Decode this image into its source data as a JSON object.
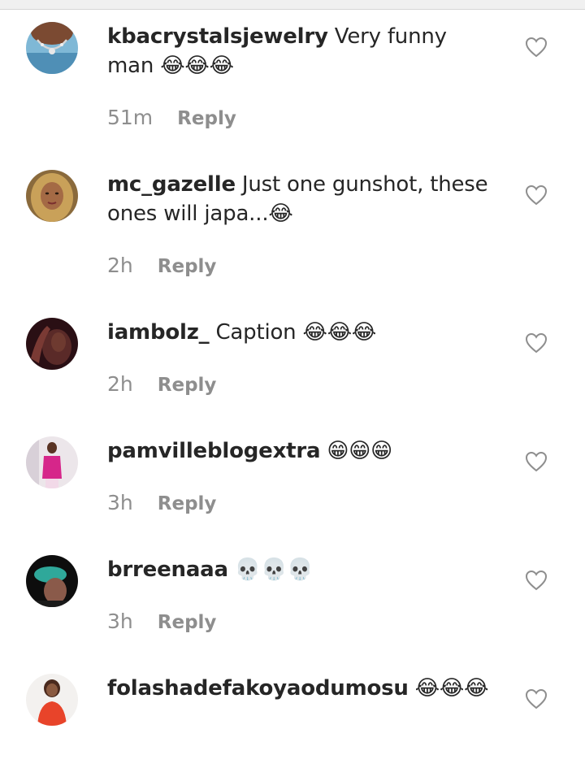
{
  "comments": [
    {
      "username": "kbacrystalsjewelry",
      "text": "Very funny man 😂😂😂",
      "time": "51m",
      "reply_label": "Reply",
      "avatar_icon": "avatar-jewelry-photo",
      "like_icon": "heart-outline-icon"
    },
    {
      "username": "mc_gazelle",
      "text": "Just one gunshot, these ones will japa...😂",
      "time": "2h",
      "reply_label": "Reply",
      "avatar_icon": "avatar-woman-photo",
      "like_icon": "heart-outline-icon"
    },
    {
      "username": "iambolz_",
      "text": "Caption 😂😂😂",
      "time": "2h",
      "reply_label": "Reply",
      "avatar_icon": "avatar-dark-photo",
      "like_icon": "heart-outline-icon"
    },
    {
      "username": "pamvilleblogextra",
      "text": "😁😁😁",
      "time": "3h",
      "reply_label": "Reply",
      "avatar_icon": "avatar-pink-outfit-photo",
      "like_icon": "heart-outline-icon"
    },
    {
      "username": "brreenaaa",
      "text": "💀💀💀",
      "time": "3h",
      "reply_label": "Reply",
      "avatar_icon": "avatar-teal-photo",
      "like_icon": "heart-outline-icon"
    },
    {
      "username": "folashadefakoyaodumosu",
      "text": "😂😂😂",
      "avatar_icon": "avatar-red-outfit-photo",
      "like_icon": "heart-outline-icon"
    }
  ]
}
